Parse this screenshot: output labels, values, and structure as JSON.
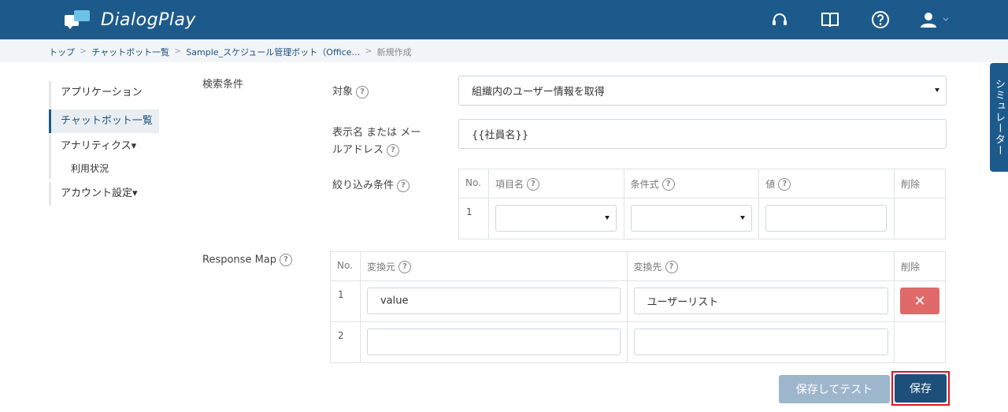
{
  "app": {
    "name": "DialogPlay"
  },
  "topbar": {
    "icons": [
      "headset-icon",
      "book-icon",
      "help-icon",
      "user-icon"
    ]
  },
  "breadcrumb": {
    "items": [
      "トップ",
      "チャットボット一覧",
      "Sample_スケジュール管理ボット（Office…",
      "新規作成"
    ]
  },
  "sidebar": {
    "items": [
      {
        "label": "アプリケーション"
      },
      {
        "label": "チャットボット一覧"
      },
      {
        "label": "アナリティクス▾"
      },
      {
        "label": "利用状況"
      },
      {
        "label": "アカウント設定▾"
      }
    ]
  },
  "form": {
    "search_conditions_label": "検索条件",
    "target_label": "対象",
    "target_value": "組織内のユーザー情報を取得",
    "display_name_label_line1": "表示名 または メー",
    "display_name_label_line2": "ルアドレス",
    "display_name_value": "{{社員名}}",
    "filter_label": "絞り込み条件",
    "filter_table": {
      "headers": [
        "No.",
        "項目名",
        "条件式",
        "値",
        "削除"
      ],
      "rows": [
        {
          "no": "1"
        }
      ]
    },
    "response_map_label": "Response Map",
    "response_table": {
      "headers": [
        "No.",
        "変換元",
        "変換先",
        "削除"
      ],
      "rows": [
        {
          "no": "1",
          "source": "value",
          "target": "ユーザーリスト"
        },
        {
          "no": "2",
          "source": "",
          "target": ""
        }
      ]
    }
  },
  "actions": {
    "save_and_test": "保存してテスト",
    "save": "保存"
  },
  "simulator_tab": "シミュレーター",
  "colors": {
    "header": "#1d5a8c",
    "accent_light": "#6cc3e8",
    "delete": "#e06a6a",
    "save_test_disabled": "#9db6cc",
    "highlight": "#e0141e"
  }
}
